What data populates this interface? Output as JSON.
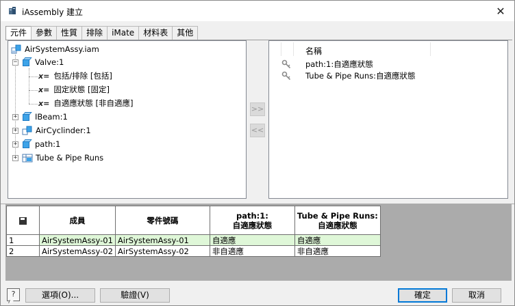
{
  "window": {
    "title": "iAssembly 建立",
    "close_glyph": "✕"
  },
  "tabs": [
    "元件",
    "參數",
    "性質",
    "排除",
    "iMate",
    "材料表",
    "其他"
  ],
  "tree": {
    "root": "AirSystemAssy.iam",
    "items": [
      {
        "label": "Valve:1",
        "expander": "−"
      },
      {
        "label": "包括/排除 [包括]",
        "prefix": "x="
      },
      {
        "label": "固定狀態 [固定]",
        "prefix": "x="
      },
      {
        "label": "自適應狀態 [非自適應]",
        "prefix": "x="
      },
      {
        "label": "IBeam:1",
        "expander": "+"
      },
      {
        "label": "AirCyclinder:1",
        "expander": "+"
      },
      {
        "label": "path:1",
        "expander": "+"
      },
      {
        "label": "Tube & Pipe Runs",
        "expander": "+"
      }
    ]
  },
  "move_buttons": {
    "add": ">>",
    "remove": "<<"
  },
  "table_list": {
    "header": "名稱",
    "rows": [
      "path:1:自適應狀態",
      "Tube & Pipe Runs:自適應狀態"
    ]
  },
  "grid": {
    "headers": [
      "成員",
      "零件號碼",
      "path:1:\n自適應狀態",
      "Tube & Pipe Runs:\n自適應狀態"
    ],
    "header_lines": {
      "col3_line1": "path:1:",
      "col3_line2": "自適應狀態",
      "col4_line1": "Tube & Pipe Runs:",
      "col4_line2": "自適應狀態"
    },
    "rows": [
      {
        "index": "1",
        "member": "AirSystemAssy-01",
        "part_number": "AirSystemAssy-01",
        "path": "自適應",
        "tube": "自適應"
      },
      {
        "index": "2",
        "member": "AirSystemAssy-02",
        "part_number": "AirSystemAssy-02",
        "path": "非自適應",
        "tube": "非自適應"
      }
    ],
    "highlight_color": "#dff7d8"
  },
  "buttons": {
    "help": "?",
    "options": "選項(O)...",
    "verify": "驗證(V)",
    "ok": "確定",
    "cancel": "取消"
  },
  "colors": {
    "accent": "#0078d7",
    "cube": "#3da3e8"
  }
}
